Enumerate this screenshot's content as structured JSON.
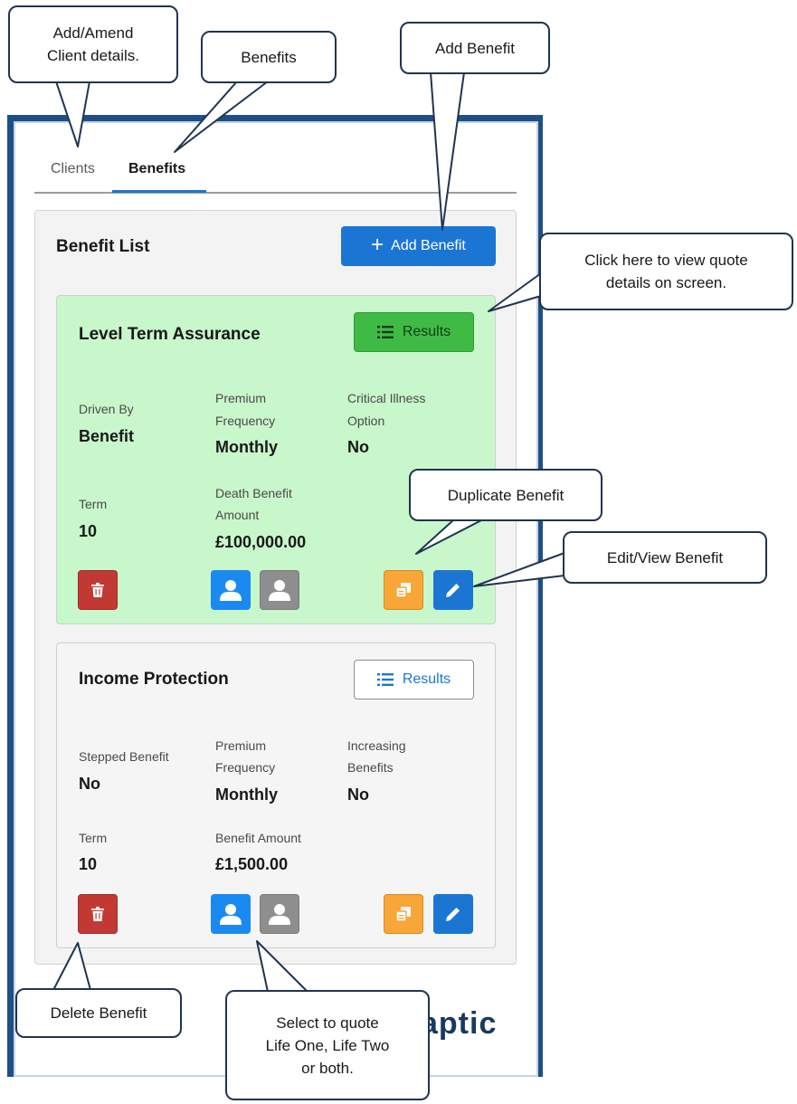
{
  "tabs": [
    {
      "label": "Clients"
    },
    {
      "label": "Benefits"
    }
  ],
  "benefit_list": {
    "title": "Benefit List",
    "add_button": {
      "icon": "+",
      "label": "Add Benefit"
    }
  },
  "benefits": [
    {
      "name": "Level Term Assurance",
      "results_label": "Results",
      "fields": {
        "driven_by_label": "Driven By",
        "driven_by_value": "Benefit",
        "premium_label_1": "Premium",
        "premium_label_2": "Frequency",
        "premium_value": "Monthly",
        "critical_label_1": "Critical Illness",
        "critical_label_2": "Option",
        "critical_value": "No",
        "term_label": "Term",
        "term_value": "10",
        "death_label_1": "Death Benefit",
        "death_label_2": "Amount",
        "death_value": "£100,000.00"
      }
    },
    {
      "name": "Income Protection",
      "results_label": "Results",
      "fields": {
        "stepped_label": "Stepped Benefit",
        "stepped_value": "No",
        "premium_label_1": "Premium",
        "premium_label_2": "Frequency",
        "premium_value": "Monthly",
        "increasing_label_1": "Increasing",
        "increasing_label_2": "Benefits",
        "increasing_value": "No",
        "term_label": "Term",
        "term_value": "10",
        "amount_label": "Benefit Amount",
        "amount_value": "£1,500.00"
      }
    }
  ],
  "logo_text": "aptic",
  "callouts": {
    "clients_line1": "Add/Amend",
    "clients_line2": "Client details.",
    "benefits": "Benefits",
    "add_benefit": "Add Benefit",
    "results_line1": "Click here to view quote",
    "results_line2": "details on screen.",
    "duplicate": "Duplicate Benefit",
    "edit": "Edit/View Benefit",
    "delete": "Delete Benefit",
    "select_line1": "Select to quote",
    "select_line2": "Life One, Life Two",
    "select_line3": "or both."
  },
  "colors": {
    "primary_blue": "#1b76d3",
    "card_green": "#c8f7cb",
    "results_green": "#3fbb45",
    "delete_red": "#c23934",
    "duplicate_orange": "#f7a637",
    "frame_navy": "#1f4f86"
  }
}
